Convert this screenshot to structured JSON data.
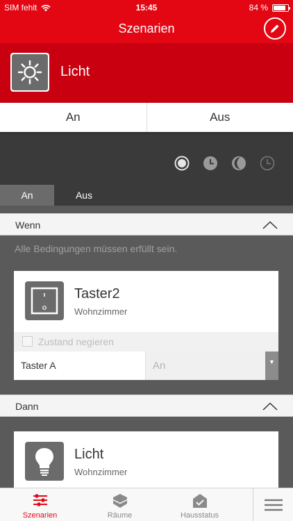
{
  "status": {
    "carrier": "SIM fehlt",
    "time": "15:45",
    "battery": "84 %",
    "battery_level": 0.84
  },
  "header": {
    "title": "Szenarien"
  },
  "scene": {
    "name": "Licht",
    "icon": "sun-icon"
  },
  "toggle": {
    "on_label": "An",
    "off_label": "Aus",
    "selected": "Aus"
  },
  "mode_icons": [
    "radio-icon",
    "clock-icon",
    "moon-icon",
    "clock-outline-icon"
  ],
  "subtabs": {
    "on_label": "An",
    "off_label": "Aus",
    "selected": "An"
  },
  "when": {
    "header": "Wenn",
    "hint": "Alle Bedingungen müssen erfüllt sein.",
    "device": {
      "name": "Taster2",
      "room": "Wohnzimmer",
      "icon": "switch-icon"
    },
    "negate_label": "Zustand negieren",
    "negate_checked": false,
    "trigger_label": "Taster A",
    "trigger_value": "An"
  },
  "then": {
    "header": "Dann",
    "device": {
      "name": "Licht",
      "room": "Wohnzimmer",
      "icon": "bulb-icon"
    }
  },
  "tabbar": {
    "items": [
      {
        "label": "Szenarien",
        "icon": "sliders-icon",
        "active": true
      },
      {
        "label": "Räume",
        "icon": "cube-icon",
        "active": false
      },
      {
        "label": "Hausstatus",
        "icon": "house-check-icon",
        "active": false
      }
    ],
    "menu_icon": "menu-icon"
  },
  "colors": {
    "brand_red": "#e30613",
    "dark_red": "#c8000f",
    "panel_dark": "#3a3a3a",
    "gray": "#5a5a5a"
  }
}
